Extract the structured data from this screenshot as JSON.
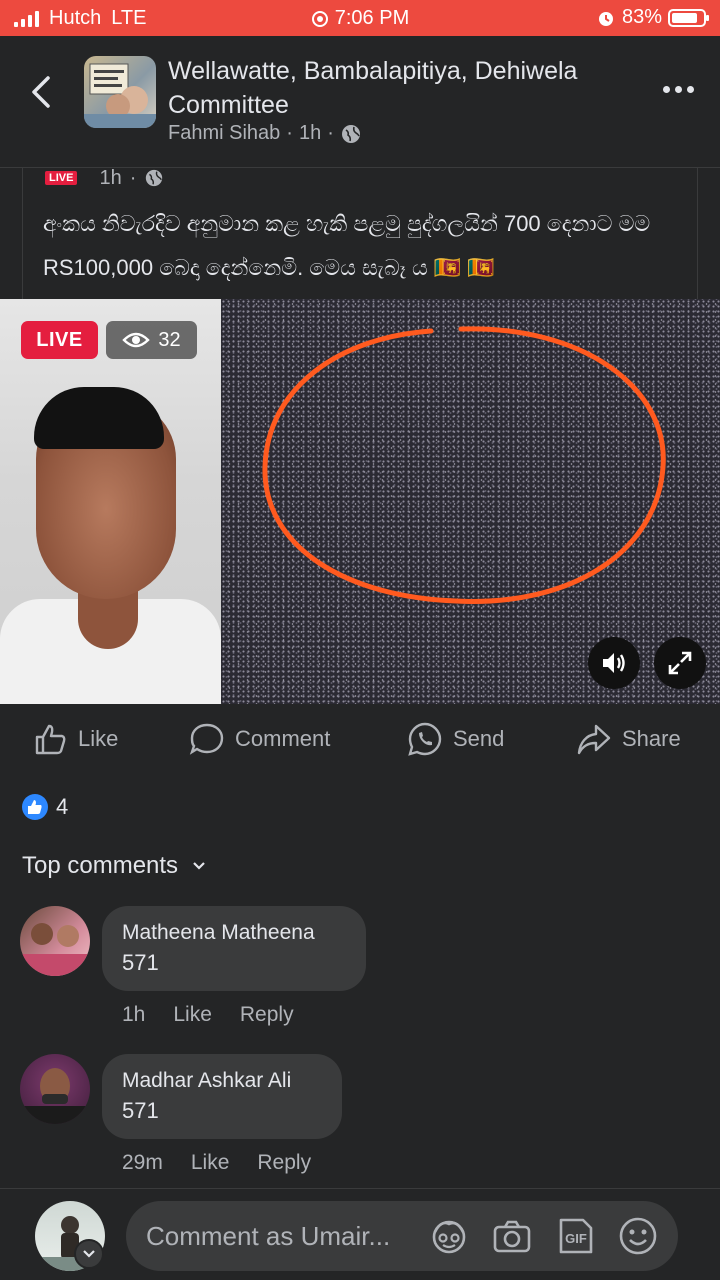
{
  "status_bar": {
    "carrier": "Hutch",
    "network": "LTE",
    "time": "7:06 PM",
    "battery": "83%",
    "battery_level": 0.83
  },
  "header": {
    "title": "Wellawatte, Bambalapitiya, Dehiwela Committee",
    "author": "Fahmi Sihab",
    "time": "1h",
    "separator": "·"
  },
  "shared_post": {
    "live_tag": "LIVE",
    "time": "1h",
    "separator": "·",
    "text": "අංකය නිවැරදිව අනුමාන කළ හැකි පළමු පුද්ගලයින් 700 දෙනාට මම RS100,000 බෙදා දෙන්නෙමි. මෙය සැබෑ ය 🇱🇰 🇱🇰"
  },
  "video": {
    "live_label": "LIVE",
    "viewer_count": "32",
    "accent": "#e41e3f",
    "circle_color": "#ff5a1f"
  },
  "actions": {
    "like": "Like",
    "comment": "Comment",
    "send": "Send",
    "share": "Share"
  },
  "reactions": {
    "count": "4",
    "color": "#2d88ff"
  },
  "comments_section": {
    "heading": "Top comments",
    "items": [
      {
        "name": "Matheena Matheena",
        "text": "571",
        "time": "1h",
        "like": "Like",
        "reply": "Reply"
      },
      {
        "name": "Madhar Ashkar Ali",
        "text": "571",
        "time": "29m",
        "like": "Like",
        "reply": "Reply"
      }
    ]
  },
  "composer": {
    "placeholder": "Comment as Umair..."
  }
}
